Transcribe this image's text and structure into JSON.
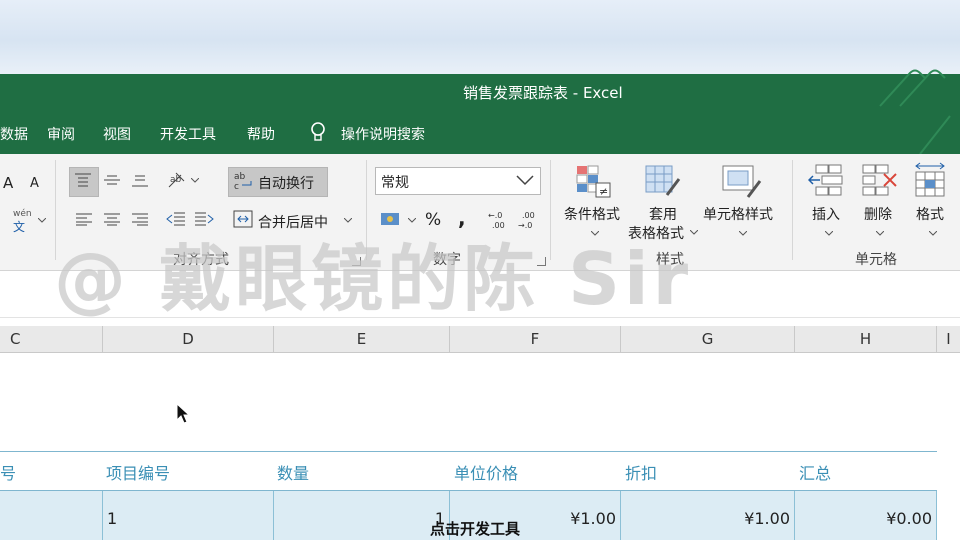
{
  "window": {
    "title": "销售发票跟踪表  -  Excel"
  },
  "menu": {
    "items": [
      "数据",
      "审阅",
      "视图",
      "开发工具",
      "帮助"
    ],
    "search": "操作说明搜索"
  },
  "ribbon": {
    "font_grow": "A",
    "font_shrink": "A",
    "phonetic_top": "wén",
    "phonetic_bottom": "文",
    "wrap_text": "自动换行",
    "merge_center": "合并后居中",
    "alignment_group": "对齐方式",
    "number_format": "常规",
    "percent": "%",
    "comma": ",",
    "number_group": "数字",
    "conditional_format": "条件格式",
    "table_format_line1": "套用",
    "table_format_line2": "表格格式",
    "cell_styles": "单元格样式",
    "styles_group": "样式",
    "insert": "插入",
    "delete": "删除",
    "format": "格式",
    "cells_group": "单元格"
  },
  "columns": [
    "C",
    "D",
    "E",
    "F",
    "G",
    "H",
    "I"
  ],
  "table": {
    "headers": [
      "号",
      "项目编号",
      "数量",
      "单位价格",
      "折扣",
      "汇总"
    ],
    "rows": [
      {
        "item_no": "1",
        "qty": "1",
        "unit_price": "¥1.00",
        "discount": "¥1.00",
        "total": "¥0.00"
      }
    ]
  },
  "overlay": {
    "watermark": "@ 戴眼镜的陈 Sir",
    "subtitle": "点击开发工具"
  }
}
